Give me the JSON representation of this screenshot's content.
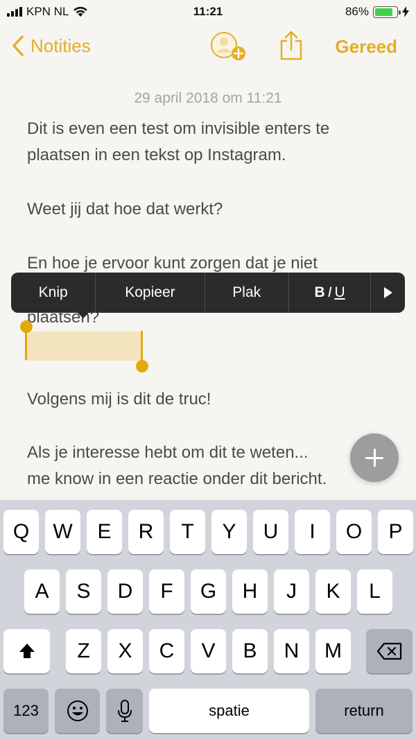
{
  "status_bar": {
    "carrier": "KPN NL",
    "time": "11:21",
    "battery_percent": "86%",
    "battery_level": 0.86
  },
  "nav": {
    "back_label": "Notities",
    "done_label": "Gereed",
    "icons": [
      "chevron-left-icon",
      "add-person-icon",
      "share-icon"
    ]
  },
  "note": {
    "date": "29 april 2018 om 11:21",
    "lines": [
      "Dit is even een test om invisible enters te",
      "plaatsen in een tekst op Instagram.",
      "Weet jij dat hoe dat werkt?",
      "En hoe je ervoor kunt zorgen dat je niet",
      "plaatsen?",
      "Volgens mij is dit de truc!",
      "Als je interesse hebt om dit te weten...",
      "me know in een reactie onder dit bericht."
    ]
  },
  "edit_menu": {
    "cut": "Knip",
    "copy": "Kopieer",
    "paste": "Plak",
    "bold": "B",
    "italic": "I",
    "underline": "U",
    "more_icon": "play-arrow-icon"
  },
  "keyboard": {
    "row1": [
      "Q",
      "W",
      "E",
      "R",
      "T",
      "Y",
      "U",
      "I",
      "O",
      "P"
    ],
    "row2": [
      "A",
      "S",
      "D",
      "F",
      "G",
      "H",
      "J",
      "K",
      "L"
    ],
    "row3": [
      "Z",
      "X",
      "C",
      "V",
      "B",
      "N",
      "M"
    ],
    "numbers": "123",
    "space": "spatie",
    "return": "return",
    "icons": [
      "shift-icon",
      "backspace-icon",
      "emoji-icon",
      "microphone-icon"
    ]
  },
  "colors": {
    "accent": "#e4ae25",
    "selection": "#f4e4bd",
    "menu_bg": "#2b2b2b",
    "keyboard_bg": "#d1d4da"
  }
}
